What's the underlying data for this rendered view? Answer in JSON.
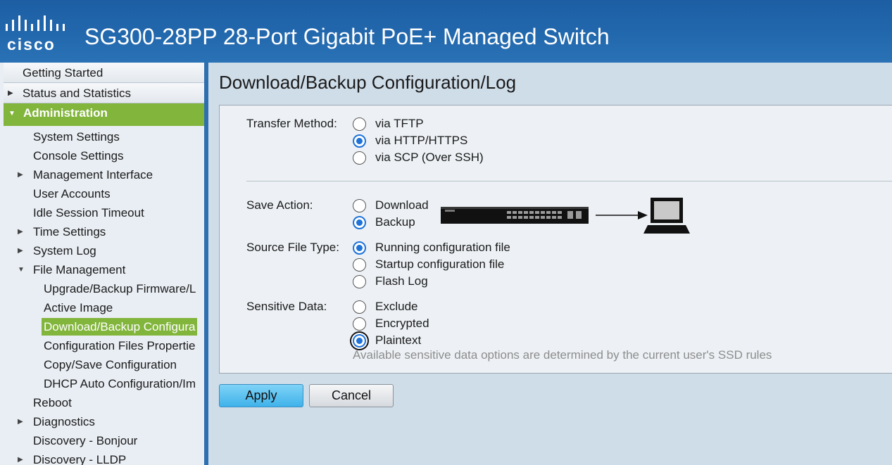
{
  "header": {
    "logo_text": "cisco",
    "title": "SG300-28PP 28-Port Gigabit PoE+ Managed Switch"
  },
  "sidebar": {
    "top_items": [
      {
        "label": "Getting Started",
        "arrow": ""
      },
      {
        "label": "Status and Statistics",
        "arrow": "▶"
      }
    ],
    "admin": {
      "label": "Administration",
      "arrow": "▼"
    },
    "items": [
      {
        "label": "System Settings",
        "arrow": "",
        "level": 2
      },
      {
        "label": "Console Settings",
        "arrow": "",
        "level": 2
      },
      {
        "label": "Management Interface",
        "arrow": "▶",
        "level": 2
      },
      {
        "label": "User Accounts",
        "arrow": "",
        "level": 2
      },
      {
        "label": "Idle Session Timeout",
        "arrow": "",
        "level": 2
      },
      {
        "label": "Time Settings",
        "arrow": "▶",
        "level": 2
      },
      {
        "label": "System Log",
        "arrow": "▶",
        "level": 2
      },
      {
        "label": "File Management",
        "arrow": "▼",
        "level": 2
      },
      {
        "label": "Upgrade/Backup Firmware/L",
        "arrow": "",
        "level": 3
      },
      {
        "label": "Active Image",
        "arrow": "",
        "level": 3
      },
      {
        "label": "Download/Backup Configura",
        "arrow": "",
        "level": 3,
        "active": true
      },
      {
        "label": "Configuration Files Propertie",
        "arrow": "",
        "level": 3
      },
      {
        "label": "Copy/Save Configuration",
        "arrow": "",
        "level": 3
      },
      {
        "label": "DHCP Auto Configuration/Im",
        "arrow": "",
        "level": 3
      },
      {
        "label": "Reboot",
        "arrow": "",
        "level": 2
      },
      {
        "label": "Diagnostics",
        "arrow": "▶",
        "level": 2
      },
      {
        "label": "Discovery - Bonjour",
        "arrow": "",
        "level": 2
      },
      {
        "label": "Discovery - LLDP",
        "arrow": "▶",
        "level": 2
      }
    ]
  },
  "main": {
    "page_title": "Download/Backup Configuration/Log",
    "transfer_method": {
      "label": "Transfer Method:",
      "options": [
        "via TFTP",
        "via HTTP/HTTPS",
        "via SCP (Over SSH)"
      ],
      "selected": "via HTTP/HTTPS"
    },
    "save_action": {
      "label": "Save Action:",
      "options": [
        "Download",
        "Backup"
      ],
      "selected": "Backup"
    },
    "source_file_type": {
      "label": "Source File Type:",
      "options": [
        "Running configuration file",
        "Startup configuration file",
        "Flash Log"
      ],
      "selected": "Running configuration file"
    },
    "sensitive_data": {
      "label": "Sensitive Data:",
      "options": [
        "Exclude",
        "Encrypted",
        "Plaintext"
      ],
      "selected": "Plaintext",
      "hint": "Available sensitive data options are determined by the current user's SSD rules"
    },
    "buttons": {
      "apply": "Apply",
      "cancel": "Cancel"
    }
  },
  "colors": {
    "header_blue": "#2268ad",
    "nav_active_green": "#82b53c",
    "radio_blue": "#1e72d8",
    "apply_blue": "#3fb2ea"
  }
}
